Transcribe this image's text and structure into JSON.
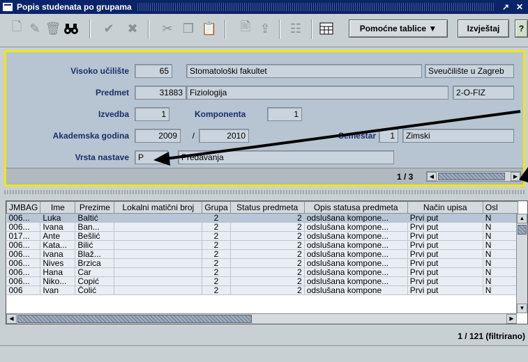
{
  "window": {
    "title": "Popis studenata po grupama",
    "maximize": "↗",
    "close": "✕"
  },
  "toolbar": {
    "pomocne_label": "Pomoćne tablice ▼",
    "izvjestaj_label": "Izvještaj"
  },
  "form": {
    "visoko_uciliste": {
      "label": "Visoko učilište",
      "code": "65",
      "name": "Stomatološki fakultet",
      "university": "Sveučilište u Zagreb"
    },
    "predmet": {
      "label": "Predmet",
      "code": "31883",
      "name": "Fiziologija",
      "short": "2-O-FIZ"
    },
    "izvedba": {
      "label": "Izvedba",
      "value": "1"
    },
    "komponenta": {
      "label": "Komponenta",
      "value": "1"
    },
    "akademska_godina": {
      "label": "Akademska godina",
      "from": "2009",
      "sep": "/",
      "to": "2010"
    },
    "semestar": {
      "label": "Semestar",
      "value": "1",
      "name": "Zimski"
    },
    "vrsta_nastave": {
      "label": "Vrsta nastave",
      "code": "P",
      "name": "Predavanja"
    },
    "navigator": {
      "count": "1 / 3"
    }
  },
  "table": {
    "columns": [
      "JMBAG",
      "Ime",
      "Prezime",
      "Lokalni matični broj",
      "Grupa",
      "Status predmeta",
      "Opis statusa predmeta",
      "Način upisa",
      "Osl"
    ],
    "rows": [
      [
        "006...",
        "Luka",
        "Baltić",
        "",
        "2",
        "2",
        "odslušana kompone...",
        "Prvi put",
        "N"
      ],
      [
        "006...",
        "Ivana",
        "Ban...",
        "",
        "2",
        "2",
        "odslušana kompone...",
        "Prvi put",
        "N"
      ],
      [
        "017...",
        "Ante",
        "Bešlić",
        "",
        "2",
        "2",
        "odslušana kompone...",
        "Prvi put",
        "N"
      ],
      [
        "006...",
        "Kata...",
        "Bilić",
        "",
        "2",
        "2",
        "odslušana kompone...",
        "Prvi put",
        "N"
      ],
      [
        "006...",
        "Ivana",
        "Blaž...",
        "",
        "2",
        "2",
        "odslušana kompone...",
        "Prvi put",
        "N"
      ],
      [
        "006...",
        "Nives",
        "Brzica",
        "",
        "2",
        "2",
        "odslušana kompone...",
        "Prvi put",
        "N"
      ],
      [
        "006...",
        "Hana",
        "Car",
        "",
        "2",
        "2",
        "odslušana kompone...",
        "Prvi put",
        "N"
      ],
      [
        "006...",
        "Niko...",
        "Copić",
        "",
        "2",
        "2",
        "odslušana kompone...",
        "Prvi put",
        "N"
      ],
      [
        "006",
        "Ivan",
        "Čolić",
        "",
        "2",
        "2",
        "odslušana kompone",
        "Prvi put",
        "N"
      ]
    ],
    "record_count": "1 / 121 (filtrirano)"
  }
}
